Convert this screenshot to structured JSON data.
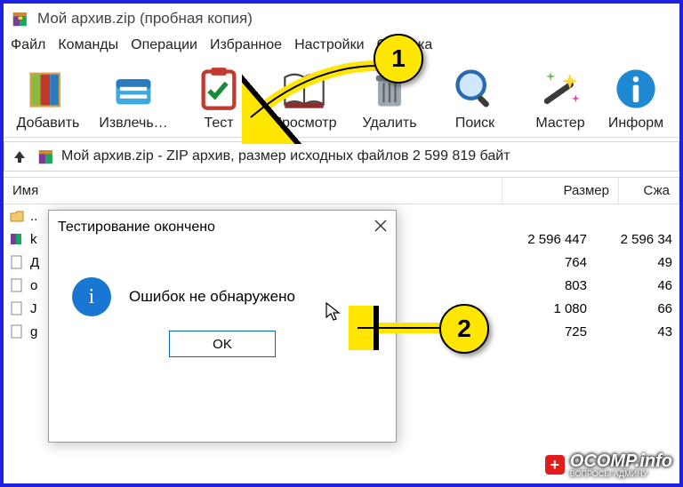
{
  "window": {
    "title": "Мой архив.zip (пробная копия)"
  },
  "menu": {
    "items": [
      {
        "label": "Файл"
      },
      {
        "label": "Команды"
      },
      {
        "label": "Операции"
      },
      {
        "label": "Избранное"
      },
      {
        "label": "Настройки"
      },
      {
        "label": "Справка"
      }
    ]
  },
  "toolbar": {
    "items": [
      {
        "label": "Добавить",
        "icon": "books-icon"
      },
      {
        "label": "Извлечь…",
        "icon": "drawer-icon"
      },
      {
        "label": "Тест",
        "icon": "checklist-icon"
      },
      {
        "label": "Просмотр",
        "icon": "open-book-icon"
      },
      {
        "label": "Удалить",
        "icon": "trash-icon"
      },
      {
        "label": "Поиск",
        "icon": "search-icon"
      },
      {
        "label": "Мастер",
        "icon": "wand-icon"
      },
      {
        "label": "Информ",
        "icon": "info-icon"
      }
    ]
  },
  "address_bar": {
    "path": "Мой архив.zip - ZIP архив, размер исходных файлов 2 599 819 байт"
  },
  "columns": {
    "name": "Имя",
    "size": "Размер",
    "packed": "Сжа"
  },
  "rows": [
    {
      "name_first": "..",
      "size": "",
      "packed": ""
    },
    {
      "name_first": "k",
      "size": "2 596 447",
      "packed": "2 596 34"
    },
    {
      "name_first": "Д",
      "size": "764",
      "packed": "49"
    },
    {
      "name_first": "o",
      "size": "803",
      "packed": "46"
    },
    {
      "name_first": "J",
      "size": "1 080",
      "packed": "66"
    },
    {
      "name_first": "g",
      "size": "725",
      "packed": "43"
    }
  ],
  "dialog": {
    "title": "Тестирование окончено",
    "message": "Ошибок не обнаружено",
    "ok_label": "OK"
  },
  "annotations": {
    "badge1": "1",
    "badge2": "2"
  },
  "watermark": {
    "brand": "OCOMP",
    "tld": ".info",
    "sub": "ВОПРОСЫ АДМИНУ"
  }
}
